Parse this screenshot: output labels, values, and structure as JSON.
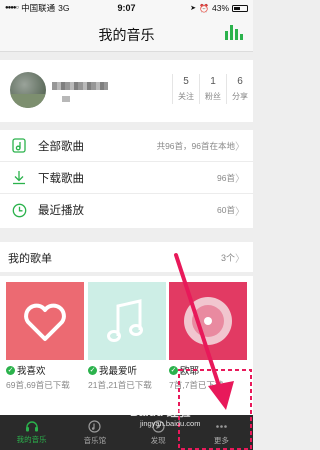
{
  "status_bar": {
    "carrier": "中国联通",
    "network": "3G",
    "time": "9:07",
    "battery": "43%"
  },
  "header": {
    "title": "我的音乐",
    "bars_icon": "equalizer-icon"
  },
  "profile": {
    "stats": [
      {
        "value": "5",
        "label": "关注"
      },
      {
        "value": "1",
        "label": "粉丝"
      },
      {
        "value": "6",
        "label": "分享"
      }
    ]
  },
  "library": {
    "items": [
      {
        "label": "全部歌曲",
        "info": "共96首，96首在本地",
        "icon": "music-file-icon"
      },
      {
        "label": "下载歌曲",
        "info": "96首",
        "icon": "download-icon"
      },
      {
        "label": "最近播放",
        "info": "60首",
        "icon": "clock-icon"
      }
    ]
  },
  "playlists": {
    "title": "我的歌单",
    "count": "3个",
    "items": [
      {
        "name": "我喜欢",
        "sub": "69首,69首已下载"
      },
      {
        "name": "我最爱听",
        "sub": "21首,21首已下载"
      },
      {
        "name": "欧耶",
        "sub": "7首,7首已下载"
      }
    ]
  },
  "tabbar": {
    "tabs": [
      {
        "label": "我的音乐",
        "icon": "headphones-icon",
        "active": true
      },
      {
        "label": "音乐馆",
        "icon": "music-hall-icon",
        "active": false
      },
      {
        "label": "发现",
        "icon": "discover-icon",
        "active": false
      },
      {
        "label": "更多",
        "icon": "more-icon",
        "active": false
      }
    ]
  },
  "watermark": {
    "line1": "Baidu 经验",
    "line2": "jingyan.baidu.com"
  },
  "colors": {
    "accent": "#2bb24c",
    "annotation": "#e8195a",
    "tabbar": "#2a2a2a"
  }
}
